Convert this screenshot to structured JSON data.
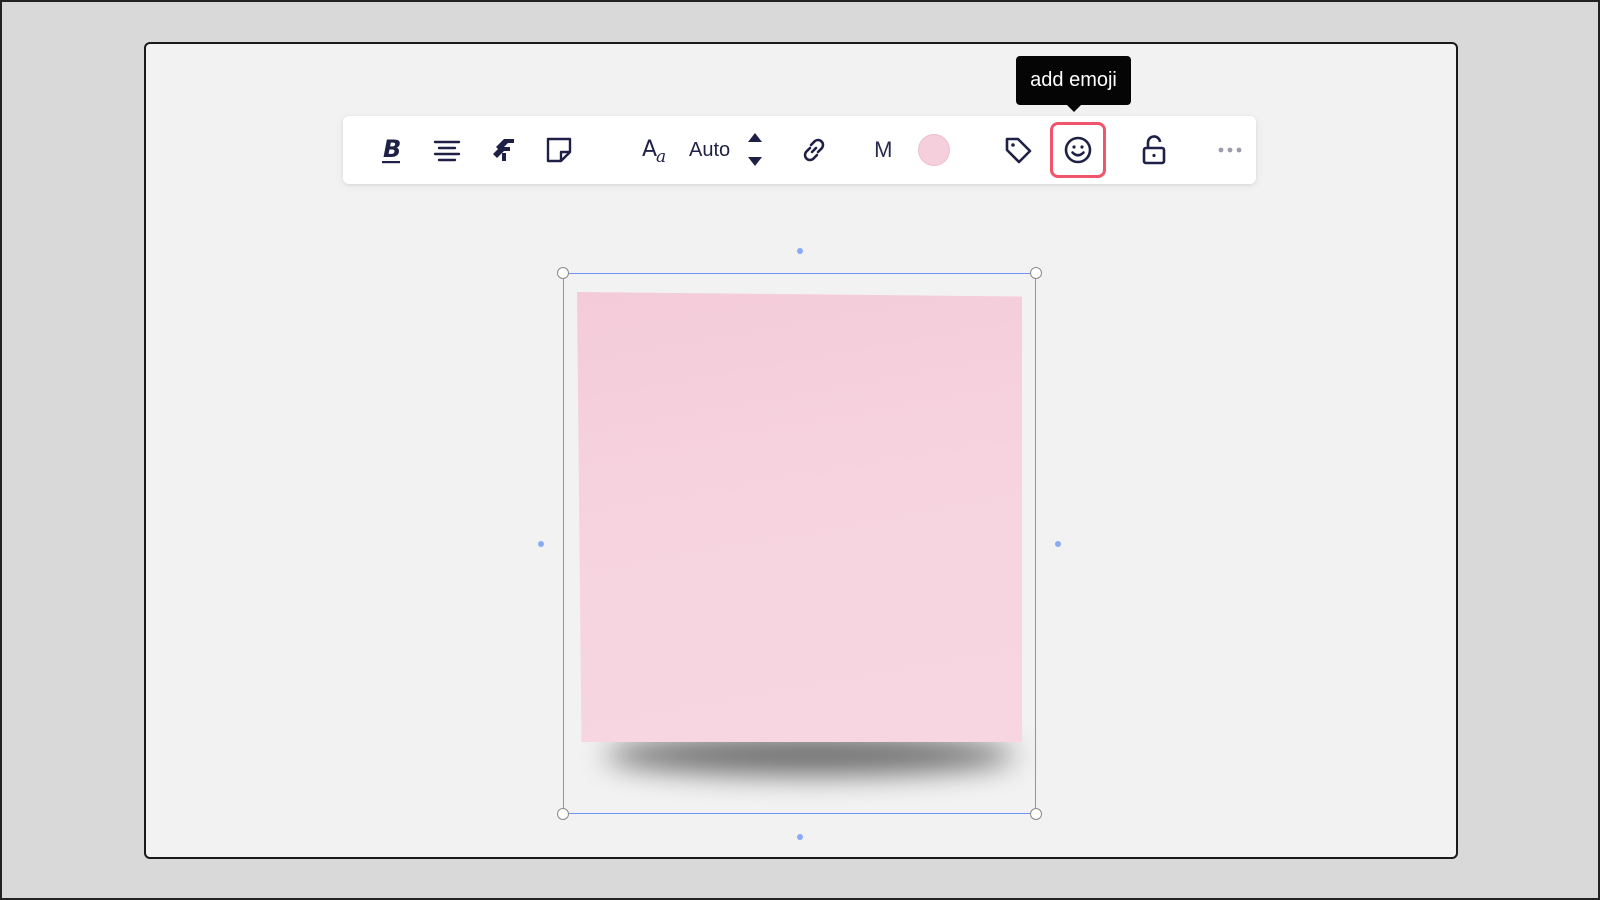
{
  "toolbar": {
    "font_size_value": "Auto",
    "shape_letter": "M",
    "swatch_color": "#f5cfdb",
    "highlight_color": "#f0556c",
    "icons": [
      "bold-icon",
      "align-center-icon",
      "layers-icon",
      "sticky-note-icon",
      "font-icon",
      "stepper-up-icon",
      "stepper-down-icon",
      "link-icon",
      "tag-icon",
      "emoji-icon",
      "lock-icon",
      "more-icon"
    ]
  },
  "tooltip": {
    "text": "add emoji"
  },
  "sticky_note": {
    "color": "#f5cfdb",
    "text": ""
  },
  "selection": {
    "color": "#6f95f3"
  }
}
